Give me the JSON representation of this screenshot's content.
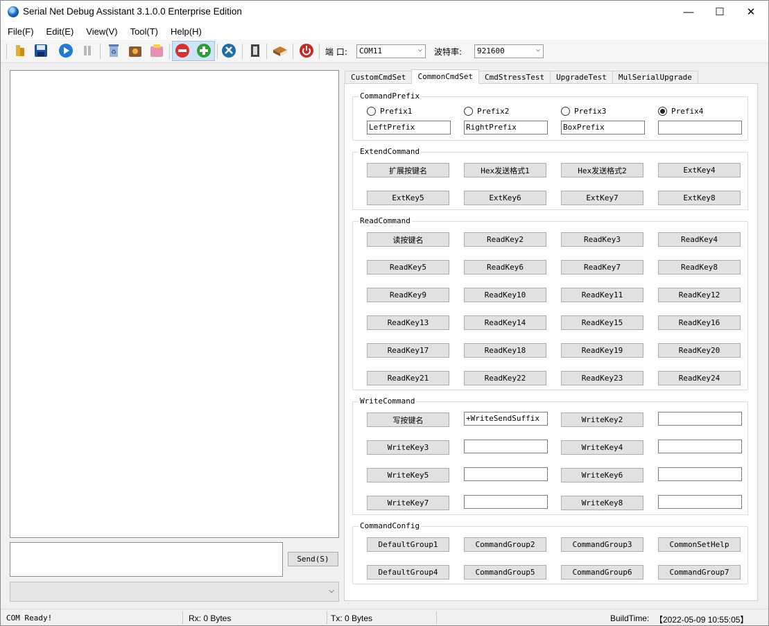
{
  "window": {
    "title": "Serial Net Debug Assistant 3.1.0.0 Enterprise Edition",
    "minimize": "—",
    "maximize": "☐",
    "close": "✕"
  },
  "menu": [
    "File(F)",
    "Edit(E)",
    "View(V)",
    "Tool(T)",
    "Help(H)"
  ],
  "toolbar": {
    "icons": [
      "open-icon",
      "save-icon",
      "play-icon",
      "pause-icon",
      "recycle-bin-icon",
      "export-icon",
      "import-icon",
      "remove-icon",
      "add-icon",
      "settings-icon",
      "exit-icon",
      "book-icon",
      "power-icon"
    ],
    "port_label": "端  口:",
    "port_value": "COM11",
    "baud_label": "波特率:",
    "baud_value": "921600"
  },
  "send": {
    "button": "Send(S)",
    "input": ""
  },
  "tabs": [
    "CustomCmdSet",
    "CommonCmdSet",
    "CmdStressTest",
    "UpgradeTest",
    "MulSerialUpgrade"
  ],
  "active_tab": "CommonCmdSet",
  "prefix": {
    "title": "CommandPrefix",
    "radios": [
      "Prefix1",
      "Prefix2",
      "Prefix3",
      "Prefix4"
    ],
    "selected": "Prefix4",
    "values": [
      "LeftPrefix",
      "RightPrefix",
      "BoxPrefix",
      ""
    ]
  },
  "extend": {
    "title": "ExtendCommand",
    "buttons": [
      "扩展按键名",
      "Hex发送格式1",
      "Hex发送格式2",
      "ExtKey4",
      "ExtKey5",
      "ExtKey6",
      "ExtKey7",
      "ExtKey8"
    ]
  },
  "read": {
    "title": "ReadCommand",
    "buttons": [
      "读按键名",
      "ReadKey2",
      "ReadKey3",
      "ReadKey4",
      "ReadKey5",
      "ReadKey6",
      "ReadKey7",
      "ReadKey8",
      "ReadKey9",
      "ReadKey10",
      "ReadKey11",
      "ReadKey12",
      "ReadKey13",
      "ReadKey14",
      "ReadKey15",
      "ReadKey16",
      "ReadKey17",
      "ReadKey18",
      "ReadKey19",
      "ReadKey20",
      "ReadKey21",
      "ReadKey22",
      "ReadKey23",
      "ReadKey24"
    ]
  },
  "write": {
    "title": "WriteCommand",
    "rows": [
      {
        "b1": "写按键名",
        "v1": "+WriteSendSuffix",
        "b2": "WriteKey2",
        "v2": ""
      },
      {
        "b1": "WriteKey3",
        "v1": "",
        "b2": "WriteKey4",
        "v2": ""
      },
      {
        "b1": "WriteKey5",
        "v1": "",
        "b2": "WriteKey6",
        "v2": ""
      },
      {
        "b1": "WriteKey7",
        "v1": "",
        "b2": "WriteKey8",
        "v2": ""
      }
    ]
  },
  "config": {
    "title": "CommandConfig",
    "buttons": [
      "DefaultGroup1",
      "CommandGroup2",
      "CommandGroup3",
      "CommonSetHelp",
      "DefaultGroup4",
      "CommandGroup5",
      "CommandGroup6",
      "CommandGroup7"
    ]
  },
  "status": {
    "ready": "COM Ready!",
    "rx": "Rx: 0 Bytes",
    "tx": "Tx: 0 Bytes",
    "build_label": "BuildTime:",
    "build_value": "【2022-05-09 10:55:05】"
  },
  "colors": {
    "accent": "#1e6fc4",
    "remove": "#d9302b",
    "add": "#2e9d3a"
  }
}
